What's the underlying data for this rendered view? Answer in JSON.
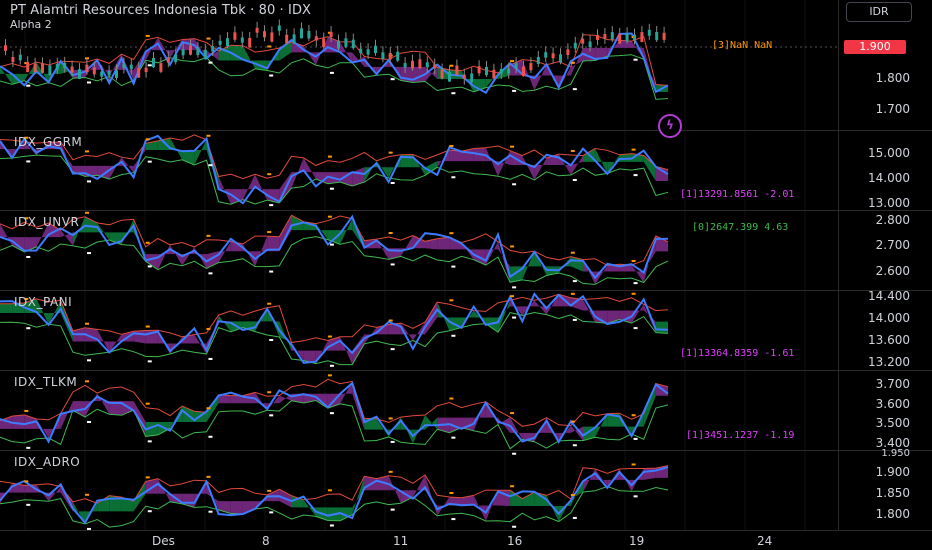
{
  "header": {
    "title": "PT Alamtri Resources Indonesia Tbk · 80 · IDX",
    "subtitle": "Alpha 2"
  },
  "currency_button": "IDR",
  "last_price": "1.900",
  "main_overlay_label": "[3]NaN NaN",
  "lightning_icon": "lightning-bolt-icon",
  "colors": {
    "price_line": "#3d7bff",
    "upper_band": "#e04a3a",
    "lower_band": "#3fb950",
    "fill_bear": "#7a2a86",
    "fill_bull": "#0b7a3b",
    "accent_red": "#f23645",
    "label_orange": "#ff9800",
    "label_magenta": "#e040fb",
    "label_green": "#3fb950"
  },
  "panes": [
    {
      "id": "main",
      "ticks": [
        "1.900",
        "1.800",
        "1.700"
      ]
    },
    {
      "id": "ggrm",
      "label": "IDX_GGRM",
      "ticks": [
        "15.000",
        "14.000",
        "13.000"
      ],
      "value_label": "[1]13291.8561 -2.01"
    },
    {
      "id": "unvr",
      "label": "IDX_UNVR",
      "ticks": [
        "2.800",
        "2.700",
        "2.600"
      ],
      "value_label": "[0]2647.399 4.63"
    },
    {
      "id": "pani",
      "label": "IDX_PANI",
      "ticks": [
        "14.400",
        "14.000",
        "13.600",
        "13.200"
      ],
      "value_label": "[1]13364.8359 -1.61"
    },
    {
      "id": "tlkm",
      "label": "IDX_TLKM",
      "ticks": [
        "3.700",
        "3.600",
        "3.500",
        "3.400"
      ],
      "value_label": "[1]3451.1237 -1.19"
    },
    {
      "id": "adro",
      "label": "IDX_ADRO",
      "ticks": [
        "1.950",
        "1.900",
        "1.850",
        "1.800"
      ]
    }
  ],
  "x_axis": [
    "Des",
    "8",
    "11",
    "16",
    "19",
    "24"
  ]
}
